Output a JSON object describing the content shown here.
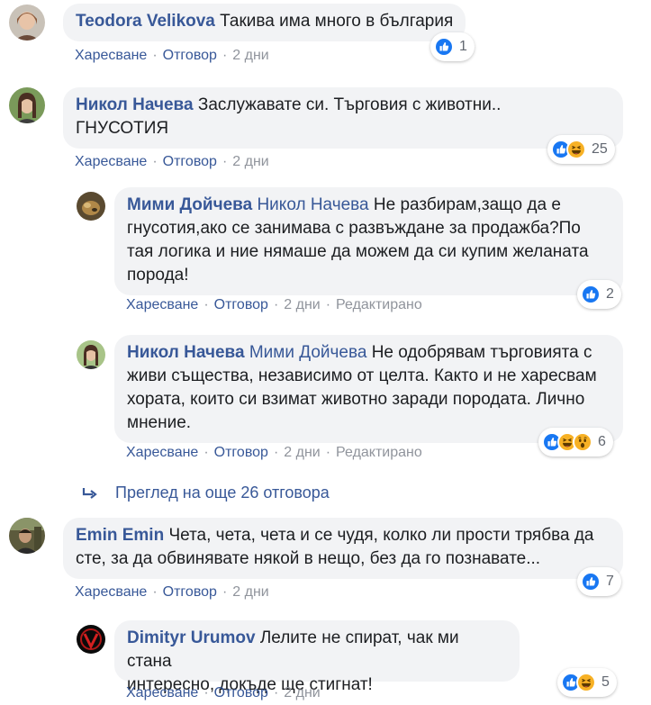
{
  "colors": {
    "link": "#385898",
    "bubble": "#f2f3f5",
    "meta": "#90949c",
    "like": "#1877f2",
    "haha": "#f7b125"
  },
  "comments": [
    {
      "author": "Teodora Velikova",
      "text": "Такива има много в българия",
      "actions": {
        "like": "Харесване",
        "reply": "Отговор",
        "time": "2 дни"
      },
      "reactions": {
        "icons": [
          "like-icon"
        ],
        "count": "1"
      }
    },
    {
      "author": "Никол Начева",
      "text_line1": "Заслужавате си. Търговия с животни..",
      "text_line2": "ГНУСОТИЯ",
      "actions": {
        "like": "Харесване",
        "reply": "Отговор",
        "time": "2 дни"
      },
      "reactions": {
        "icons": [
          "like-icon",
          "haha-icon"
        ],
        "count": "25"
      }
    },
    {
      "author": "Мими Дойчева",
      "mention": "Никол Начева",
      "text_line1": "Не разбирам,защо да е",
      "text_line2": "гнусотия,ако се занимава с развъждане за продажба?По",
      "text_line3": "тая логика и ние нямаше да можем да си купим желаната",
      "text_line4": "порода!",
      "actions": {
        "like": "Харесване",
        "reply": "Отговор",
        "time": "2 дни",
        "edited": "Редактирано"
      },
      "reactions": {
        "icons": [
          "like-icon"
        ],
        "count": "2"
      }
    },
    {
      "author": "Никол Начева",
      "mention": "Мими Дойчева",
      "text_line1": "Не одобрявам търговията с",
      "text_line2": "живи същества, независимо от целта. Както и не харесвам",
      "text_line3": "хората, които си взимат животно заради породата. Лично",
      "text_line4": "мнение.",
      "actions": {
        "like": "Харесване",
        "reply": "Отговор",
        "time": "2 дни",
        "edited": "Редактирано"
      },
      "reactions": {
        "icons": [
          "like-icon",
          "haha-icon",
          "wow-icon"
        ],
        "count": "6"
      }
    },
    {
      "author": "Emin Emin",
      "text_line1": "Чета, чета, чета и се чудя, колко ли прости трябва да",
      "text_line2": "сте, за да обвинявате някой в нещо, без да го познавате...",
      "actions": {
        "like": "Харесване",
        "reply": "Отговор",
        "time": "2 дни"
      },
      "reactions": {
        "icons": [
          "like-icon"
        ],
        "count": "7"
      }
    },
    {
      "author": "Dimityr Urumov",
      "text_line1": "Лелите не спират, чак ми стана",
      "text_line2": "интересно, докъде ще стигнат!",
      "actions": {
        "like": "Харесване",
        "reply": "Отговор",
        "time": "2 дни"
      },
      "reactions": {
        "icons": [
          "like-icon",
          "haha-icon"
        ],
        "count": "5"
      }
    }
  ],
  "more_replies": "Преглед на още 26 отговора"
}
